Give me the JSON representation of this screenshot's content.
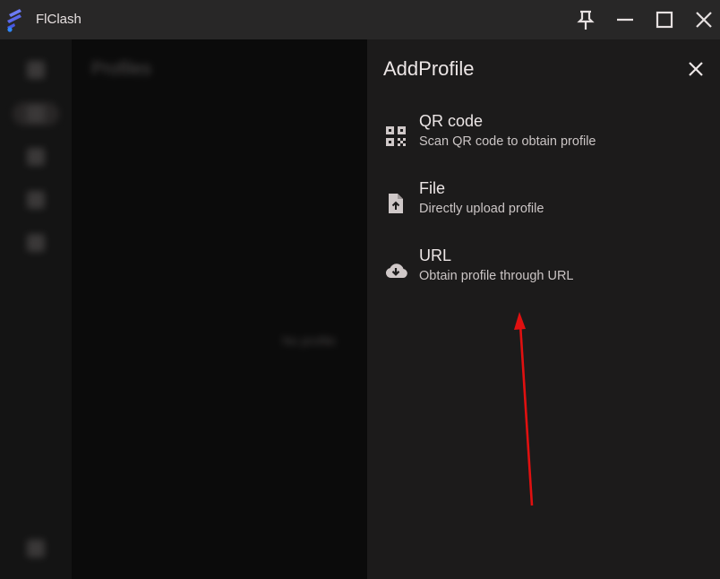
{
  "window": {
    "title": "FlClash"
  },
  "background": {
    "page_title": "Profiles",
    "empty_text": "No profile"
  },
  "sheet": {
    "title": "AddProfile",
    "options": [
      {
        "label": "QR code",
        "description": "Scan QR code to obtain profile",
        "icon": "qr-code-icon"
      },
      {
        "label": "File",
        "description": "Directly upload profile",
        "icon": "upload-file-icon"
      },
      {
        "label": "URL",
        "description": "Obtain profile through URL",
        "icon": "cloud-download-icon"
      }
    ]
  },
  "colors": {
    "titlebar": "#282727",
    "sheet": "#1c1b1b",
    "backdrop": "#0b0b0b",
    "annotation": "#e01010"
  }
}
